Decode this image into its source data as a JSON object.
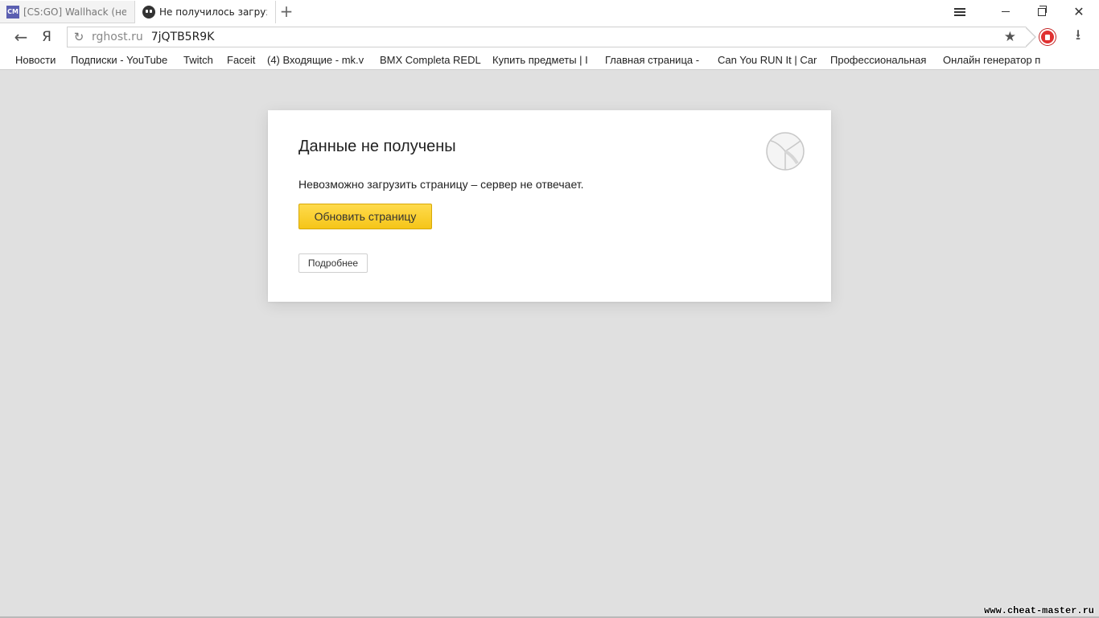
{
  "tabs": [
    {
      "title": "[CS:GO] Wallhack (не т",
      "favicon": "cm-favicon",
      "favicon_text": "CM",
      "active": false
    },
    {
      "title": "Не получилось загруз",
      "favicon": "ghost-favicon",
      "active": true
    }
  ],
  "new_tab_label": "+",
  "window_controls": {
    "close_symbol": "✕"
  },
  "toolbar": {
    "back_symbol": "←",
    "yandex_button": "Я",
    "reload_symbol": "↻",
    "url_host": "rghost.ru",
    "url_path": "7jQTB5R9K",
    "star_symbol": "★",
    "download_symbol": "⭳"
  },
  "bookmarks": [
    "Новости",
    "Подписки - YouTube",
    "Twitch",
    "Faceit",
    "(4) Входящие - mk.v",
    "BMX Completa REDL",
    "Купить предметы | I",
    "Главная страница -",
    "Can You RUN It | Car",
    "Профессиональная",
    "Онлайн генератор п"
  ],
  "error": {
    "title": "Данные не получены",
    "message": "Невозможно загрузить страницу – сервер не отвечает.",
    "reload_label": "Обновить страницу",
    "details_label": "Подробнее"
  },
  "watermark": "www.cheat-master.ru",
  "colors": {
    "page_bg": "#e0e0e0",
    "button_yellow": "#ffd633",
    "extension_red": "#e03131"
  }
}
